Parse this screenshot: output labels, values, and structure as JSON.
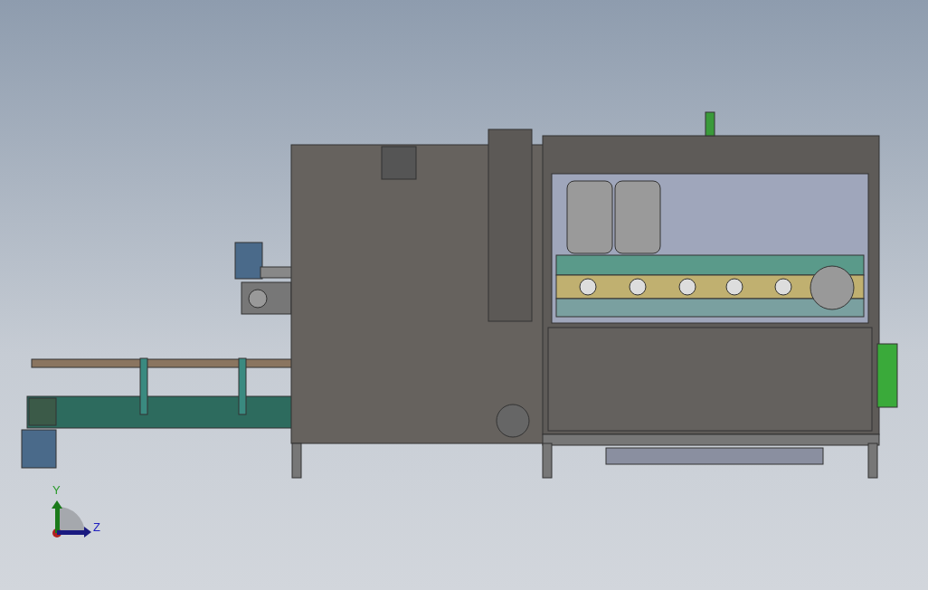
{
  "viewport": {
    "triad": {
      "y_label": "Y",
      "z_label": "Z"
    }
  }
}
